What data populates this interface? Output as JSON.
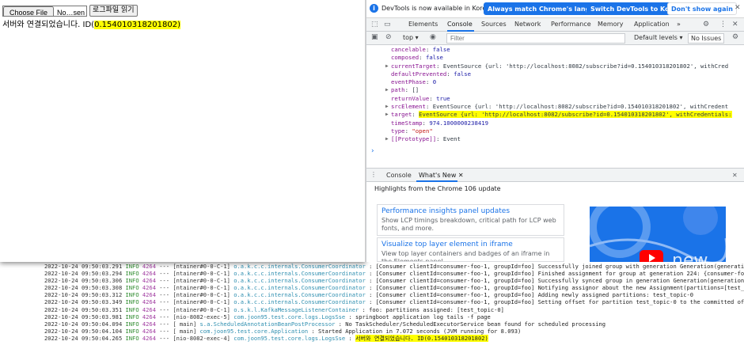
{
  "page": {
    "read_button_label": "로그파일 읽기",
    "status_prefix": "서버와 연결되었습니다. ID(",
    "status_id": "0.154010318201802",
    "status_suffix": ")"
  },
  "devtools": {
    "infobar": {
      "message": "DevTools is now available in Korean!",
      "match_language_label": "Always match Chrome's language",
      "switch_label": "Switch DevTools to Korean",
      "dont_show_label": "Don't show again",
      "close_glyph": "✕"
    },
    "tabs": [
      "Elements",
      "Console",
      "Sources",
      "Network",
      "Performance",
      "Memory",
      "Application"
    ],
    "more_tabs_glyph": "»",
    "toolbar": {
      "context": "top",
      "filter_placeholder": "Filter",
      "levels_label": "Default levels ▾",
      "issues_label": "No Issues"
    },
    "console_lines": [
      {
        "indent": 0,
        "tri": "",
        "key": "cancelable",
        "rest": "false",
        "cls": "v"
      },
      {
        "indent": 0,
        "tri": "",
        "key": "composed",
        "rest": "false",
        "cls": "v"
      },
      {
        "indent": 0,
        "tri": "▶",
        "key": "currentTarget",
        "rest": "EventSource {url: 'http://localhost:8082/subscribe?id=0.154010318201802', withCred",
        "cls": "n"
      },
      {
        "indent": 0,
        "tri": "",
        "key": "defaultPrevented",
        "rest": "false",
        "cls": "v"
      },
      {
        "indent": 0,
        "tri": "",
        "key": "eventPhase",
        "rest": "0",
        "cls": "v"
      },
      {
        "indent": 0,
        "tri": "▶",
        "key": "path",
        "rest": "[]",
        "cls": "n"
      },
      {
        "indent": 0,
        "tri": "",
        "key": "returnValue",
        "rest": "true",
        "cls": "v"
      },
      {
        "indent": 0,
        "tri": "▶",
        "key": "srcElement",
        "rest": "EventSource {url: 'http://localhost:8082/subscribe?id=0.154010318201802', withCredent",
        "cls": "n"
      },
      {
        "indent": 0,
        "tri": "▶",
        "key": "target",
        "rest": "EventSource {url: 'http://localhost:8082/subscribe?id=0.154010318201802', withCredentials:",
        "cls": "n"
      },
      {
        "indent": 0,
        "tri": "",
        "key": "timeStamp",
        "rest": "974.1000000238419",
        "cls": "v"
      },
      {
        "indent": 0,
        "tri": "",
        "key": "type",
        "rest": "\"open\"",
        "cls": "s"
      },
      {
        "indent": 0,
        "tri": "▶",
        "key": "[[Prototype]]",
        "rest": "Event",
        "cls": "n"
      }
    ],
    "prompt_glyph": "›",
    "drawer": {
      "tabs": [
        "Console",
        "What's New"
      ],
      "close_glyph": "✕",
      "highlights_title": "Highlights from the Chrome 106 update",
      "cards": [
        {
          "title": "Performance insights panel updates",
          "desc": "Show LCP timings breakdown, critical path for LCP web fonts, and more."
        },
        {
          "title": "Visualize top layer element in iframe",
          "desc": "View top layer containers and badges of an iframe in the Elements panel."
        }
      ],
      "video_text": "new"
    }
  },
  "terminal": {
    "lines": [
      {
        "ts": "2022-10-24 09:50:03.291",
        "lv": "INFO",
        "pid": "4264",
        "th": "--- [ntainer#0-0-C-1]",
        "cls": "o.a.k.c.c.internals.ConsumerCoordinator",
        "msg": ": [Consumer clientId=consumer-foo-1, groupId=foo] Successfully joined group with generation Generation(generation"
      },
      {
        "ts": "2022-10-24 09:50:03.294",
        "lv": "INFO",
        "pid": "4264",
        "th": "--- [ntainer#0-0-C-1]",
        "cls": "o.a.k.c.c.internals.ConsumerCoordinator",
        "msg": ": [Consumer clientId=consumer-foo-1, groupId=foo] Finished assignment for group at generation 224: {consumer-foo-"
      },
      {
        "ts": "2022-10-24 09:50:03.306",
        "lv": "INFO",
        "pid": "4264",
        "th": "--- [ntainer#0-0-C-1]",
        "cls": "o.a.k.c.c.internals.ConsumerCoordinator",
        "msg": ": [Consumer clientId=consumer-foo-1, groupId=foo] Successfully synced group in generation Generation(generationI"
      },
      {
        "ts": "2022-10-24 09:50:03.308",
        "lv": "INFO",
        "pid": "4264",
        "th": "--- [ntainer#0-0-C-1]",
        "cls": "o.a.k.c.c.internals.ConsumerCoordinator",
        "msg": ": [Consumer clientId=consumer-foo-1, groupId=foo] Notifying assignor about the new Assignment(partitions=[test_t"
      },
      {
        "ts": "2022-10-24 09:50:03.312",
        "lv": "INFO",
        "pid": "4264",
        "th": "--- [ntainer#0-0-C-1]",
        "cls": "o.a.k.c.c.internals.ConsumerCoordinator",
        "msg": ": [Consumer clientId=consumer-foo-1, groupId=foo] Adding newly assigned partitions: test_topic-0"
      },
      {
        "ts": "2022-10-24 09:50:03.349",
        "lv": "INFO",
        "pid": "4264",
        "th": "--- [ntainer#0-0-C-1]",
        "cls": "o.a.k.c.c.internals.ConsumerCoordinator",
        "msg": ": [Consumer clientId=consumer-foo-1, groupId=foo] Setting offset for partition test_topic-0 to the committed off"
      },
      {
        "ts": "2022-10-24 09:50:03.351",
        "lv": "INFO",
        "pid": "4264",
        "th": "--- [ntainer#0-0-C-1]",
        "cls": "o.s.k.l.KafkaMessageListenerContainer",
        "msg": ": foo: partitions assigned: [test_topic-0]"
      },
      {
        "ts": "2022-10-24 09:50:03.981",
        "lv": "INFO",
        "pid": "4264",
        "th": "--- [nio-8082-exec-5]",
        "cls": "com.joon95.test.core.logs.LogsSse",
        "msg": ": springboot application log tails -f page"
      },
      {
        "ts": "2022-10-24 09:50:04.094",
        "lv": "INFO",
        "pid": "4264",
        "th": "--- [           main]",
        "cls": "s.a.ScheduledAnnotationBeanPostProcessor",
        "msg": ": No TaskScheduler/ScheduledExecutorService bean found for scheduled processing"
      },
      {
        "ts": "2022-10-24 09:50:04.104",
        "lv": "INFO",
        "pid": "4264",
        "th": "--- [           main]",
        "cls": "com.joon95.test.core.Application",
        "msg": ": Started Application in 7.072 seconds (JVM running for 8.093)"
      },
      {
        "ts": "2022-10-24 09:50:04.265",
        "lv": "INFO",
        "pid": "4264",
        "th": "--- [nio-8082-exec-4]",
        "cls": "com.joon95.test.core.logs.LogsSse",
        "msg_prefix": ": ",
        "msg_hl": "서버와 연결되었습니다. ID(0.154010318201802)"
      }
    ]
  },
  "colors": {
    "accent": "#1a73e8",
    "highlight": "#ffff00"
  }
}
